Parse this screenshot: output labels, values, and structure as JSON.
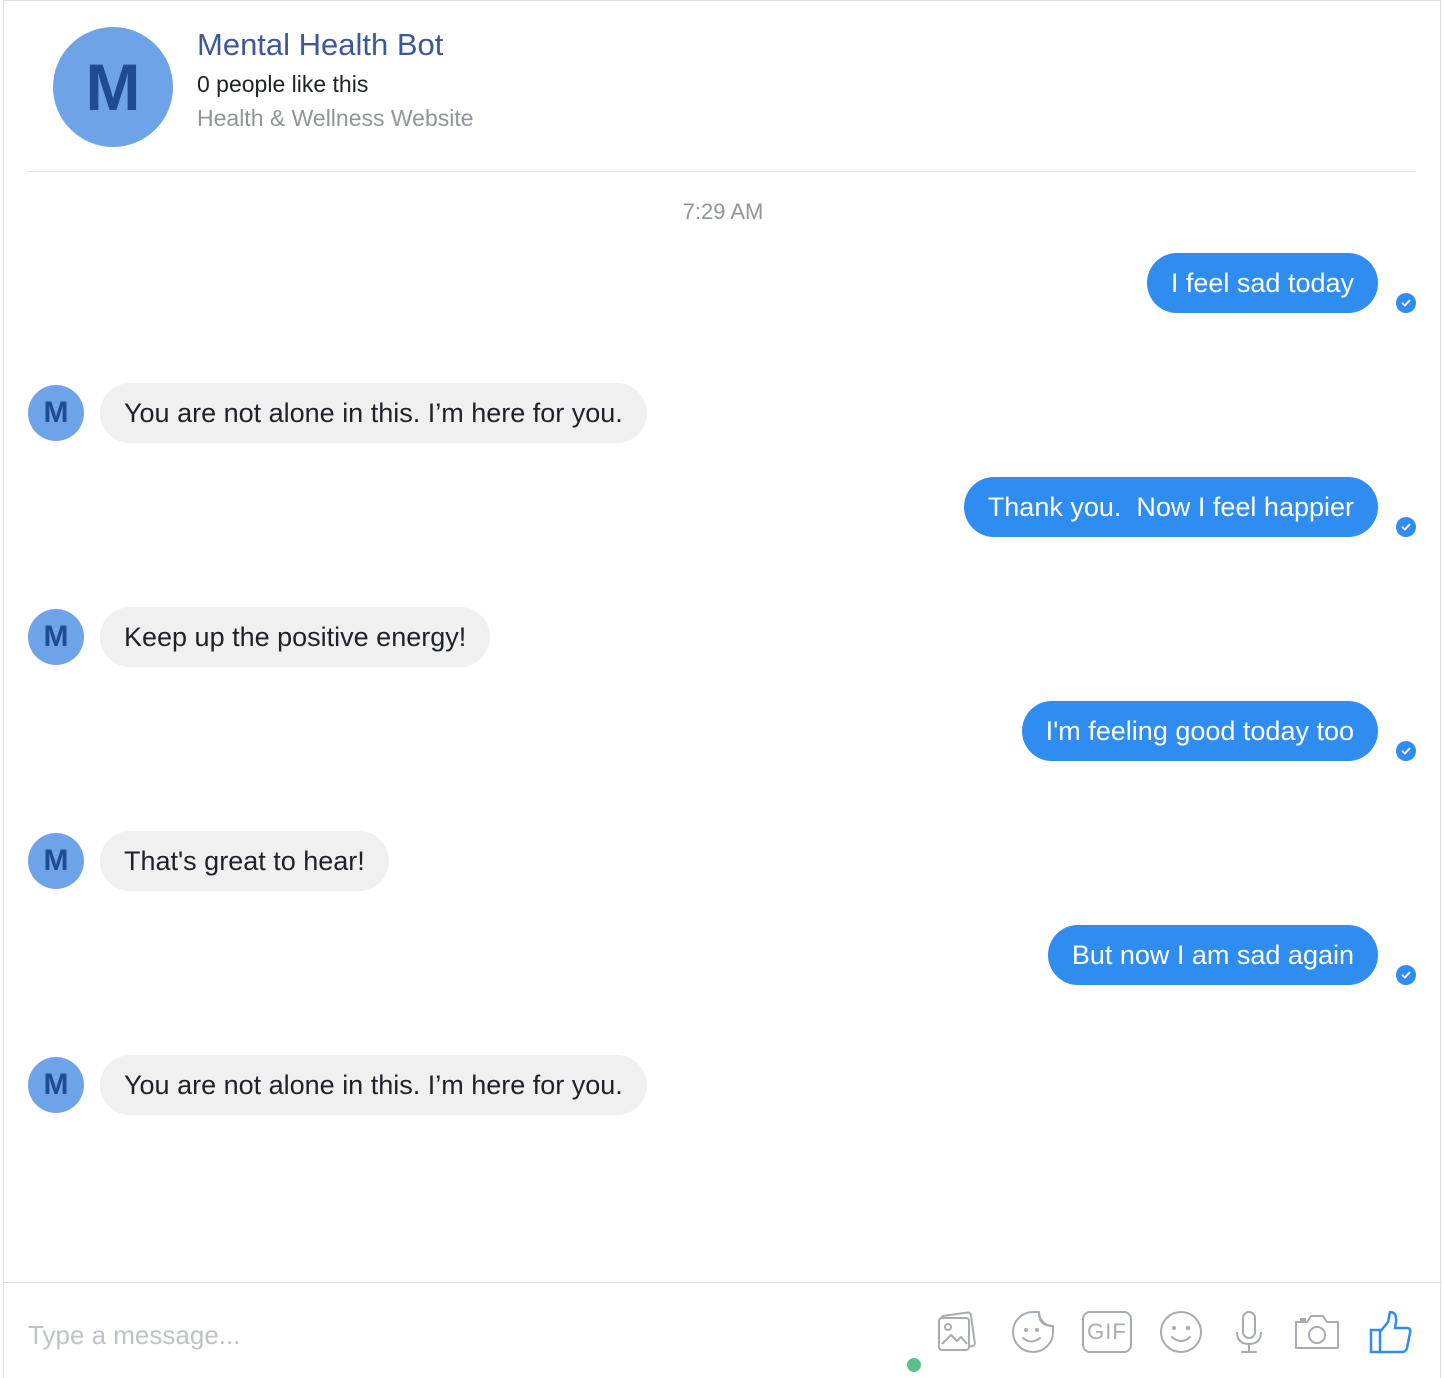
{
  "header": {
    "avatar_letter": "M",
    "title": "Mental Health Bot",
    "likes": "0 people like this",
    "category": "Health & Wellness Website"
  },
  "conversation": {
    "timestamp": "7:29 AM",
    "bot_avatar_letter": "M",
    "messages": [
      {
        "sender": "user",
        "text": "I feel sad today"
      },
      {
        "sender": "bot",
        "text": "You are not alone in this. I’m here for you."
      },
      {
        "sender": "user",
        "text": "Thank you.  Now I feel happier"
      },
      {
        "sender": "bot",
        "text": "Keep up the positive energy!"
      },
      {
        "sender": "user",
        "text": "I'm feeling good today too"
      },
      {
        "sender": "bot",
        "text": "That's great to hear!"
      },
      {
        "sender": "user",
        "text": "But now I am sad again"
      },
      {
        "sender": "bot",
        "text": "You are not alone in this. I’m here for you."
      }
    ]
  },
  "composer": {
    "placeholder": "Type a message...",
    "gif_label": "GIF",
    "tools": [
      "photo-icon",
      "sticker-icon",
      "gif-icon",
      "emoji-icon",
      "microphone-icon",
      "camera-icon",
      "thumbs-up-icon"
    ]
  },
  "colors": {
    "outgoing_bubble": "#2f8cf0",
    "incoming_bubble": "#f1f0f0",
    "avatar_bg": "#6fa3e8",
    "avatar_letter": "#1e4b91",
    "title": "#3b5998",
    "online": "#5cc08d",
    "like": "#2f8cf0"
  }
}
